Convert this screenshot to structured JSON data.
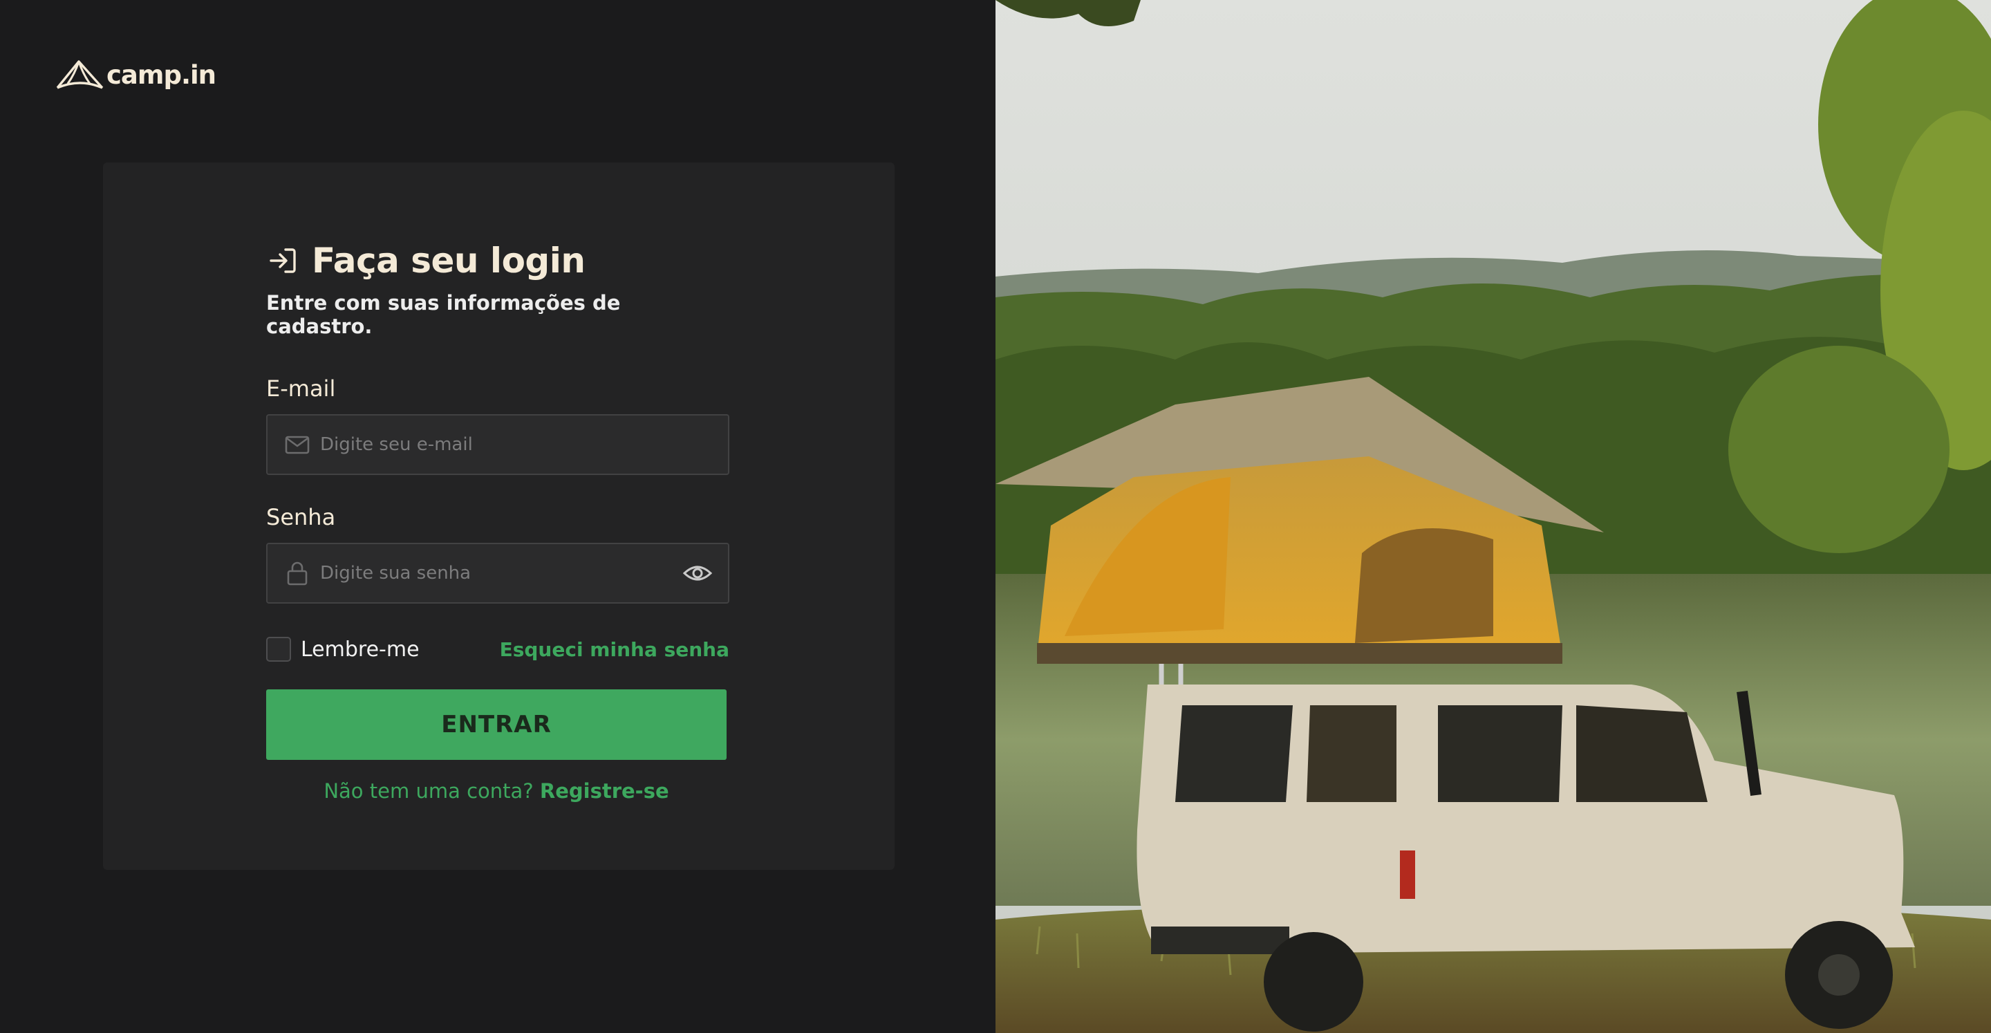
{
  "brand": {
    "name": "camp.in",
    "logo_icon": "tent-logo-icon"
  },
  "login": {
    "title": "Faça seu login",
    "title_icon": "sign-in-icon",
    "subtitle": "Entre com suas informações de cadastro.",
    "email": {
      "label": "E-mail",
      "placeholder": "Digite seu e-mail",
      "value": "",
      "icon": "mail-icon"
    },
    "password": {
      "label": "Senha",
      "placeholder": "Digite sua senha",
      "value": "",
      "icon": "lock-icon",
      "toggle_icon": "eye-icon"
    },
    "remember_label": "Lembre-me",
    "remember_checked": false,
    "forgot_label": "Esqueci minha senha",
    "submit_label": "ENTRAR",
    "signup_prompt": "Não tem uma conta?",
    "signup_link": "Registre-se"
  },
  "colors": {
    "background": "#1b1b1c",
    "card": "#232324",
    "accent_green": "#3fa85f",
    "heading_cream": "#f4ead7",
    "input_bg": "#2b2b2c",
    "input_border": "#424243"
  },
  "hero_image": {
    "subject": "off-road vehicle with a rooftop tent parked by a lake"
  }
}
